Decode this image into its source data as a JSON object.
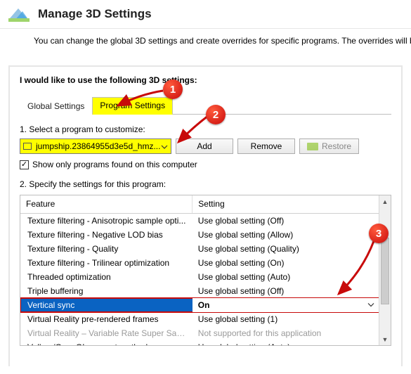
{
  "title": "Manage 3D Settings",
  "description": "You can change the global 3D settings and create overrides for specific programs. The overrides will be used automatically",
  "heading": "I would like to use the following 3D settings:",
  "tabs": {
    "global": "Global Settings",
    "program": "Program Settings"
  },
  "section1": {
    "label": "1. Select a program to customize:",
    "selected": "jumpship.23864955d3e5d_hmz...",
    "add": "Add",
    "remove": "Remove",
    "restore": "Restore",
    "checkbox": "Show only programs found on this computer"
  },
  "section2": {
    "label": "2. Specify the settings for this program:",
    "col_feature": "Feature",
    "col_setting": "Setting",
    "rows": [
      {
        "feature": "Texture filtering - Anisotropic sample opti...",
        "setting": "Use global setting (Off)"
      },
      {
        "feature": "Texture filtering - Negative LOD bias",
        "setting": "Use global setting (Allow)"
      },
      {
        "feature": "Texture filtering - Quality",
        "setting": "Use global setting (Quality)"
      },
      {
        "feature": "Texture filtering - Trilinear optimization",
        "setting": "Use global setting (On)"
      },
      {
        "feature": "Threaded optimization",
        "setting": "Use global setting (Auto)"
      },
      {
        "feature": "Triple buffering",
        "setting": "Use global setting (Off)"
      },
      {
        "feature": "Vertical sync",
        "setting": "On",
        "selected": true
      },
      {
        "feature": "Virtual Reality pre-rendered frames",
        "setting": "Use global setting (1)"
      },
      {
        "feature": "Virtual Reality – Variable Rate Super Samp...",
        "setting": "Not supported for this application",
        "disabled": true
      },
      {
        "feature": "Vulkan/OpenGL present method",
        "setting": "Use global setting (Auto)"
      }
    ]
  },
  "callouts": {
    "c1": "1",
    "c2": "2",
    "c3": "3"
  }
}
